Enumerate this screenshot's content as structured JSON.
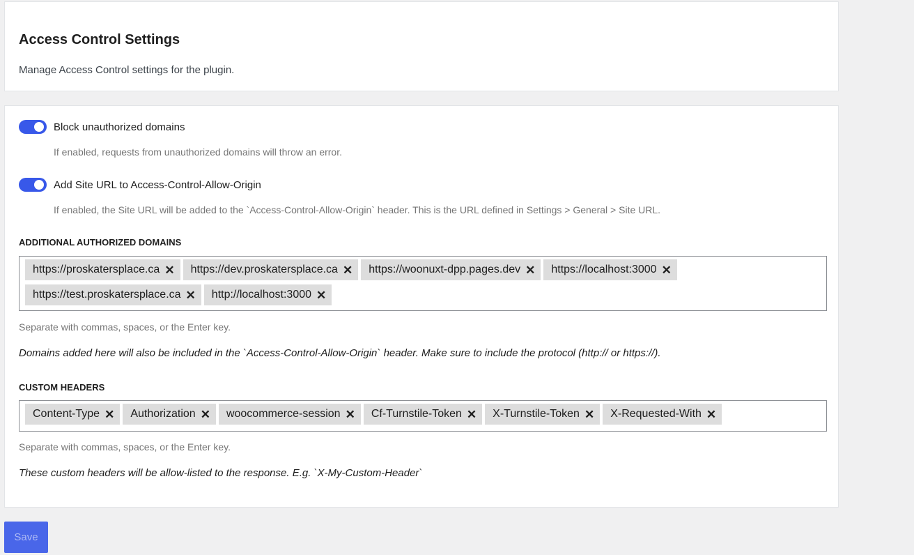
{
  "header": {
    "title": "Access Control Settings",
    "description": "Manage Access Control settings for the plugin."
  },
  "settings": {
    "block_unauthorized": {
      "label": "Block unauthorized domains",
      "enabled": true,
      "help": "If enabled, requests from unauthorized domains will throw an error."
    },
    "add_site_url": {
      "label": "Add Site URL to Access-Control-Allow-Origin",
      "enabled": true,
      "help": "If enabled, the Site URL will be added to the `Access-Control-Allow-Origin` header. This is the URL defined in Settings > General > Site URL."
    }
  },
  "domains": {
    "label": "ADDITIONAL AUTHORIZED DOMAINS",
    "tokens": [
      "https://proskatersplace.ca",
      "https://dev.proskatersplace.ca",
      "https://woonuxt-dpp.pages.dev",
      "https://localhost:3000",
      "https://test.proskatersplace.ca",
      "http://localhost:3000"
    ],
    "remove_glyph": "✕",
    "separator_help": "Separate with commas, spaces, or the Enter key.",
    "note": "Domains added here will also be included in the `Access-Control-Allow-Origin` header. Make sure to include the protocol (http:// or https://)."
  },
  "headers": {
    "label": "CUSTOM HEADERS",
    "tokens": [
      "Content-Type",
      "Authorization",
      "woocommerce-session",
      "Cf-Turnstile-Token",
      "X-Turnstile-Token",
      "X-Requested-With"
    ],
    "remove_glyph": "✕",
    "separator_help": "Separate with commas, spaces, or the Enter key.",
    "note": "These custom headers will be allow-listed to the response. E.g. `X-My-Custom-Header`"
  },
  "actions": {
    "save_label": "Save"
  },
  "colors": {
    "accent": "#3858e9",
    "token_bg": "#dddddd",
    "page_bg": "#f0f0f1"
  }
}
